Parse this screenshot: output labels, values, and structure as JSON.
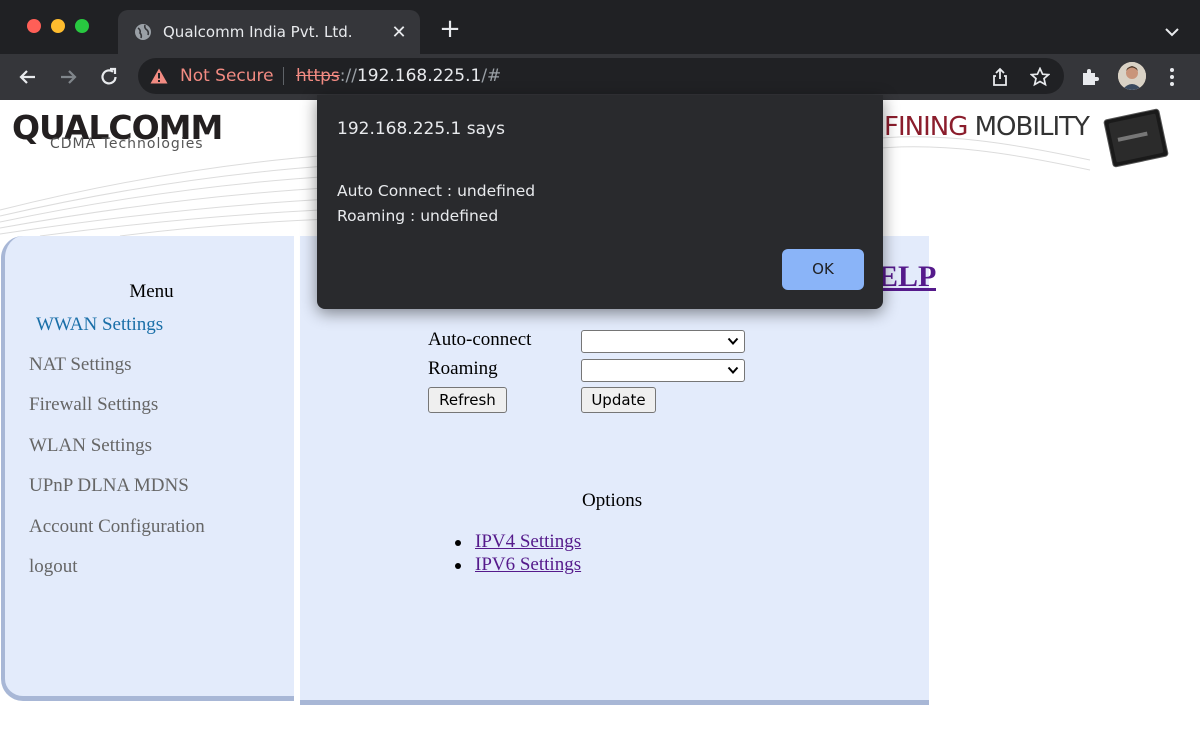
{
  "browser": {
    "tab_title": "Qualcomm India Pvt. Ltd.",
    "tab_close": "✕",
    "new_tab": "+",
    "security_label": "Not Secure",
    "url_scheme": "https",
    "url_separator": "://",
    "url_host": "192.168.225.1",
    "url_path": "/#"
  },
  "banner": {
    "logo": "QUALCOMM",
    "logo_subtitle": "CDMA Technologies",
    "tagline_part1": "FINING",
    "tagline_part2": " MOBILITY"
  },
  "sidebar": {
    "title": "Menu",
    "items": [
      {
        "label": "WWAN Settings",
        "active": true
      },
      {
        "label": "NAT Settings",
        "active": false
      },
      {
        "label": "Firewall Settings",
        "active": false
      },
      {
        "label": "WLAN Settings",
        "active": false
      },
      {
        "label": "UPnP DLNA MDNS",
        "active": false
      },
      {
        "label": "Account Configuration",
        "active": false
      },
      {
        "label": "logout",
        "active": false
      }
    ]
  },
  "main": {
    "help_link": "ELP",
    "form": {
      "auto_connect_label": "Auto-connect",
      "auto_connect_value": "",
      "roaming_label": "Roaming",
      "roaming_value": "",
      "refresh_button": "Refresh",
      "update_button": "Update"
    },
    "options_title": "Options",
    "options": [
      "IPV4 Settings",
      "IPV6 Settings"
    ]
  },
  "dialog": {
    "title": "192.168.225.1 says",
    "lines": [
      "Auto Connect : undefined",
      "Roaming : undefined"
    ],
    "ok_label": "OK"
  },
  "colors": {
    "chrome_dark": "#202124",
    "chrome_toolbar": "#35363a",
    "not_secure": "#f28b82",
    "panel_bg": "#e3ebfb",
    "active_menu": "#1a6fa8",
    "visited_link": "#551a8b",
    "dialog_bg": "#292a2d",
    "dialog_button": "#8ab4f8"
  }
}
